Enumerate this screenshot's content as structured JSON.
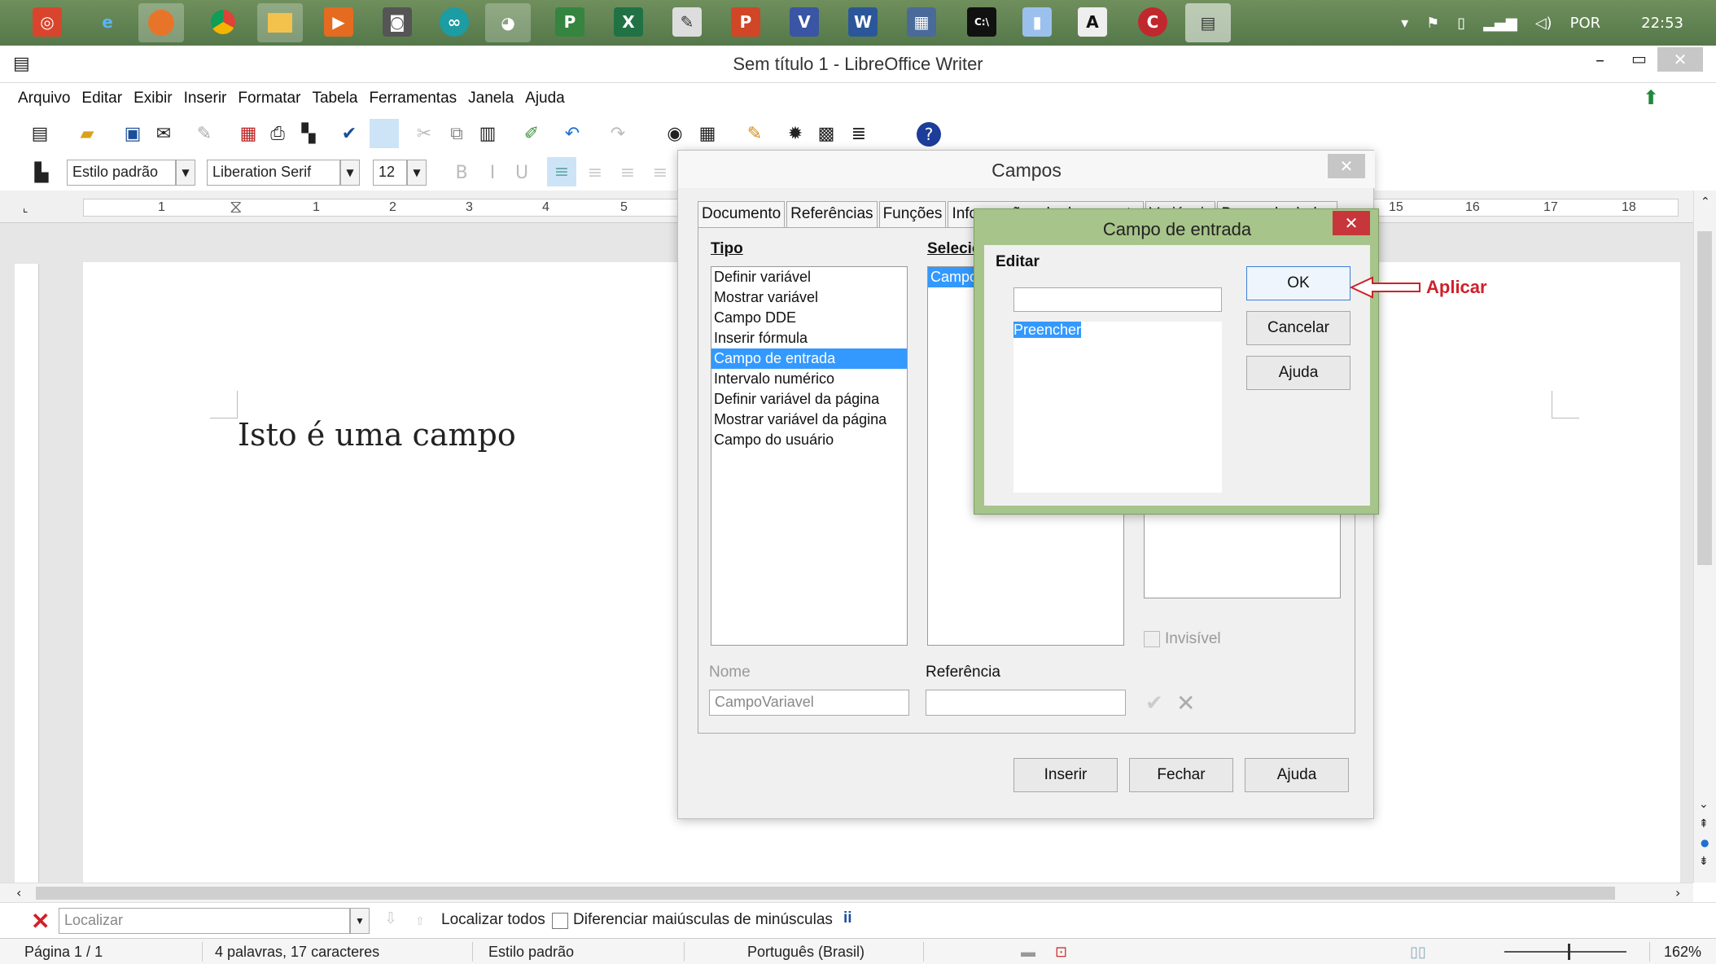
{
  "taskbar": {
    "icons": [
      "opera-icon",
      "ie-icon",
      "firefox-icon",
      "chrome-icon",
      "explorer-icon",
      "media-icon",
      "tool-icon",
      "arduino-icon",
      "paint-icon",
      "publisher-icon",
      "excel-icon",
      "notepad-icon",
      "powerpoint-icon",
      "visio-icon",
      "word-icon",
      "remote-icon",
      "cmd-icon",
      "doc-icon",
      "font-icon",
      "app-icon",
      "writer-icon"
    ],
    "lang": "POR",
    "time": "22:53"
  },
  "window": {
    "title": "Sem título 1 - LibreOffice Writer"
  },
  "menu": [
    "Arquivo",
    "Editar",
    "Exibir",
    "Inserir",
    "Formatar",
    "Tabela",
    "Ferramentas",
    "Janela",
    "Ajuda"
  ],
  "format_toolbar": {
    "paragraph_style": "Estilo padrão",
    "font_name": "Liberation Serif",
    "font_size": "12"
  },
  "ruler": {
    "numbers_left": [
      "1",
      "1",
      "2",
      "3",
      "4",
      "5"
    ],
    "numbers_right": [
      "15",
      "16",
      "17",
      "18"
    ]
  },
  "document": {
    "text": "Isto é uma campo"
  },
  "find_bar": {
    "placeholder": "Localizar",
    "find_all": "Localizar todos",
    "match_case": "Diferenciar maiúsculas de minúsculas"
  },
  "status": {
    "page": "Página 1 / 1",
    "words": "4 palavras, 17 caracteres",
    "style": "Estilo padrão",
    "language": "Português (Brasil)",
    "zoom": "162%"
  },
  "campos_dialog": {
    "title": "Campos",
    "tabs": [
      "Documento",
      "Referências",
      "Funções",
      "Informações do documento",
      "Variáveis",
      "Banco de dados"
    ],
    "tipo_label": "Tipo",
    "tipo_items": [
      "Definir variável",
      "Mostrar variável",
      "Campo DDE",
      "Inserir fórmula",
      "Campo de entrada",
      "Intervalo numérico",
      "Definir variável da página",
      "Mostrar variável da página",
      "Campo do usuário"
    ],
    "tipo_selected_index": 4,
    "selecionar_label": "Selecionar",
    "selecionar_item": "Campo",
    "invisivel_label": "Invisível",
    "nome_label": "Nome",
    "nome_value": "CampoVariavel",
    "referencia_label": "Referência",
    "referencia_value": "",
    "buttons": {
      "insert": "Inserir",
      "close": "Fechar",
      "help": "Ajuda"
    }
  },
  "entrada_dialog": {
    "title": "Campo de entrada",
    "editar_label": "Editar",
    "input_value": "",
    "text_value": "Preencher",
    "buttons": {
      "ok": "OK",
      "cancel": "Cancelar",
      "help": "Ajuda"
    }
  },
  "annotation": {
    "label": "Aplicar",
    "color": "#d0202a"
  },
  "colors": {
    "selection": "#3399ff",
    "taskbar": "#5f8250",
    "entrada_frame": "#a7c48a"
  }
}
